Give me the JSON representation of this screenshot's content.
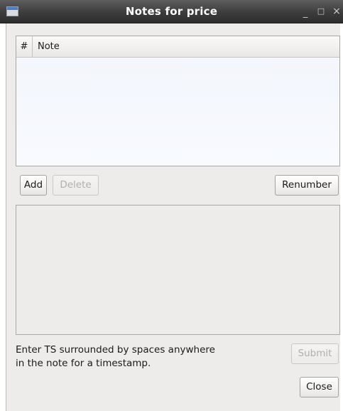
{
  "window": {
    "title": "Notes for price",
    "controls": {
      "minimize": "_",
      "maximize": "□",
      "close": "×"
    }
  },
  "table": {
    "columns": [
      "#",
      "Note"
    ],
    "rows": []
  },
  "buttons": {
    "add": "Add",
    "delete": "Delete",
    "renumber": "Renumber",
    "submit": "Submit",
    "close": "Close"
  },
  "editor": {
    "value": ""
  },
  "hint": {
    "line1": "Enter TS surrounded by spaces anywhere",
    "line2": "in the note for a timestamp."
  }
}
